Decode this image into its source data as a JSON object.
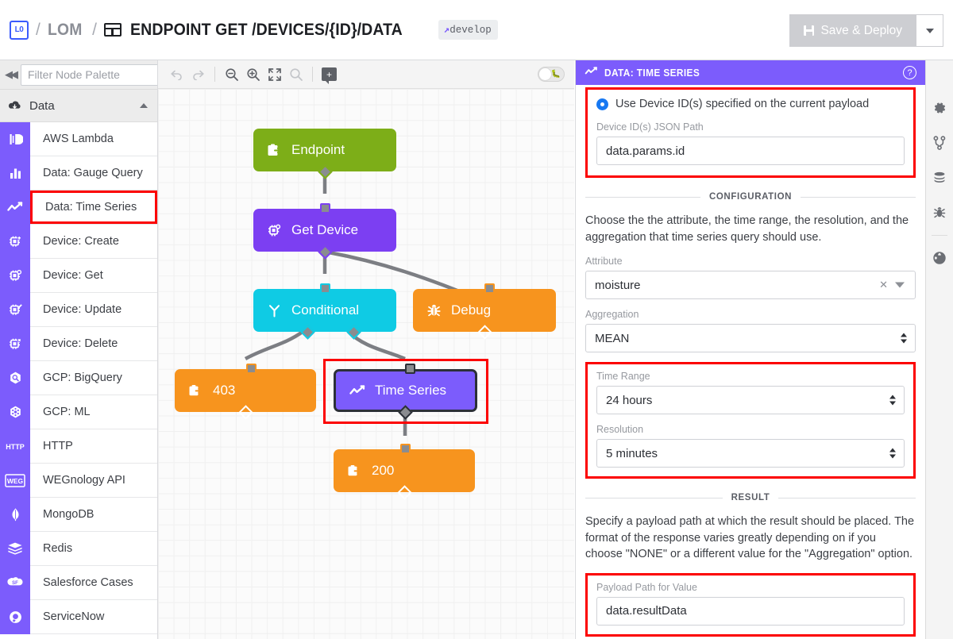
{
  "topbar": {
    "logo_text": "L0",
    "separator": "/",
    "app_name": "LOM",
    "endpoint_icon": "endpoint-icon",
    "title": "ENDPOINT GET /DEVICES/{ID}/DATA",
    "branch_prefix": "↗",
    "branch_label": "develop",
    "save_label": "Save & Deploy",
    "save_dropdown_icon": "chevron-down-icon"
  },
  "palette": {
    "collapse_icon": "collapse-left-icon",
    "filter_placeholder": "Filter Node Palette",
    "filter_value": "",
    "group": {
      "label": "Data",
      "icon": "cloud-download-icon",
      "chevron": "chevron-up-icon"
    },
    "items": [
      {
        "label": "AWS Lambda",
        "icon": "aws-lambda-icon",
        "selected": false
      },
      {
        "label": "Data: Gauge Query",
        "icon": "bar-chart-icon",
        "selected": false
      },
      {
        "label": "Data: Time Series",
        "icon": "line-chart-icon",
        "selected": true
      },
      {
        "label": "Device: Create",
        "icon": "device-plus-icon",
        "selected": false
      },
      {
        "label": "Device: Get",
        "icon": "device-get-icon",
        "selected": false
      },
      {
        "label": "Device: Update",
        "icon": "device-edit-icon",
        "selected": false
      },
      {
        "label": "Device: Delete",
        "icon": "device-delete-icon",
        "selected": false
      },
      {
        "label": "GCP: BigQuery",
        "icon": "gcp-bigquery-icon",
        "selected": false
      },
      {
        "label": "GCP: ML",
        "icon": "gcp-ml-icon",
        "selected": false
      },
      {
        "label": "HTTP",
        "icon": "http-icon",
        "selected": false
      },
      {
        "label": "WEGnology API",
        "icon": "wegnology-icon",
        "selected": false
      },
      {
        "label": "MongoDB",
        "icon": "mongodb-icon",
        "selected": false
      },
      {
        "label": "Redis",
        "icon": "redis-icon",
        "selected": false
      },
      {
        "label": "Salesforce Cases",
        "icon": "salesforce-icon",
        "selected": false
      },
      {
        "label": "ServiceNow",
        "icon": "servicenow-icon",
        "selected": false
      }
    ]
  },
  "canvas": {
    "toolbar": {
      "undo": "undo-icon",
      "redo": "redo-icon",
      "zoom_out": "zoom-out-icon",
      "zoom_in": "zoom-in-icon",
      "fit_screen": "fit-screen-icon",
      "zoom_reset": "zoom-reset-icon",
      "add_note": "add-note-icon",
      "debug_toggle": "debug-toggle",
      "debug_toggle_state": "off"
    },
    "nodes": [
      {
        "id": "endpoint",
        "label": "Endpoint",
        "icon": "endpoint-node-icon",
        "color": "#7DAE18",
        "selected": false
      },
      {
        "id": "get-device",
        "label": "Get Device",
        "icon": "device-get-icon",
        "color": "#7C3FF2",
        "selected": false
      },
      {
        "id": "conditional",
        "label": "Conditional",
        "icon": "branch-icon",
        "color": "#0FCBE4",
        "selected": false
      },
      {
        "id": "debug",
        "label": "Debug",
        "icon": "bug-icon",
        "color": "#F7941E",
        "selected": false
      },
      {
        "id": "reply-403",
        "label": "403",
        "icon": "reply-icon",
        "color": "#F7941E",
        "selected": false
      },
      {
        "id": "time-series",
        "label": "Time Series",
        "icon": "line-chart-icon",
        "color": "#7C5CFC",
        "selected": true
      },
      {
        "id": "reply-200",
        "label": "200",
        "icon": "reply-icon",
        "color": "#F7941E",
        "selected": false
      }
    ]
  },
  "panel": {
    "header": {
      "title": "DATA: TIME SERIES",
      "icon": "line-chart-icon",
      "help_icon": "help-circle-icon"
    },
    "device_section": {
      "radio_label": "Use Device ID(s) specified on the current payload",
      "radio_selected": true,
      "json_path_label": "Device ID(s) JSON Path",
      "json_path_value": "data.params.id",
      "highlighted": true
    },
    "configuration": {
      "divider_label": "CONFIGURATION",
      "description": "Choose the the attribute, the time range, the resolution, and the aggregation that time series query should use.",
      "attribute": {
        "label": "Attribute",
        "value": "moisture",
        "clear_icon": "clear-x-icon",
        "caret_icon": "chevron-down-icon"
      },
      "aggregation": {
        "label": "Aggregation",
        "value": "MEAN"
      },
      "time_range": {
        "label": "Time Range",
        "value": "24 hours",
        "highlighted": true
      },
      "resolution": {
        "label": "Resolution",
        "value": "5 minutes",
        "highlighted": true
      }
    },
    "result": {
      "divider_label": "RESULT",
      "description": "Specify a payload path at which the result should be placed. The format of the response varies greatly depending on if you choose \"NONE\" or a different value for the \"Aggregation\" option.",
      "payload_path": {
        "label": "Payload Path for Value",
        "value": "data.resultData",
        "highlighted": true
      }
    }
  },
  "rail": {
    "items": [
      {
        "icon": "gear-icon",
        "name": "settings"
      },
      {
        "icon": "branch-icon",
        "name": "versions"
      },
      {
        "icon": "database-icon",
        "name": "storage"
      },
      {
        "icon": "bug-icon",
        "name": "debug"
      },
      {
        "icon": "globe-icon",
        "name": "globals"
      }
    ]
  },
  "colors": {
    "brand_purple": "#7C5CFC",
    "highlight_red": "#FC0000",
    "accent_blue": "#1778F2",
    "node_green": "#7DAE18",
    "node_orange": "#F7941E",
    "node_cyan": "#0FCBE4",
    "node_violet": "#7C3FF2"
  }
}
